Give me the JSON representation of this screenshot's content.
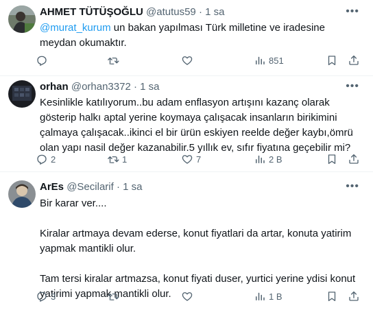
{
  "tweets": [
    {
      "name": "AHMET TÜTÜŞOĞLU",
      "handle": "@atutus59",
      "sep": "·",
      "time": "1 sa",
      "mention": "@murat_kurum",
      "text": " un bakan yapılması Türk milletine ve iradesine meydan okumaktır.",
      "replies": "",
      "retweets": "",
      "likes": "",
      "views": "851"
    },
    {
      "name": "orhan",
      "handle": "@orhan3372",
      "sep": "·",
      "time": "1 sa",
      "text": "Kesinlikle katılıyorum..bu adam enflasyon artışını kazanç olarak gösterip halkı aptal yerine koymaya çalışacak insanların birikimini çalmaya çalışacak..ikinci el bir ürün eskiyen reelde değer kaybı,ömrü olan yapı nasil değer kazanabilir.5 yıllık ev, sıfır fiyatına geçebilir mi?",
      "replies": "2",
      "retweets": "1",
      "likes": "7",
      "views": "2 B"
    },
    {
      "name": "ArEs",
      "handle": "@Secilarif",
      "sep": "·",
      "time": "1 sa",
      "text": "Bir karar ver....\n\nKiralar artmaya devam ederse, konut fiyatlari da artar, konuta yatirim yapmak mantikli olur.\n\nTam tersi kiralar artmazsa, konut fiyati duser, yurtici yerine ydisi konut yatirimi yapmak mantikli olur.",
      "replies": "3",
      "retweets": "",
      "likes": "",
      "views": "1 B"
    }
  ],
  "icons": {
    "more": "more-icon",
    "reply": "reply-icon",
    "retweet": "retweet-icon",
    "like": "heart-icon",
    "views": "views-icon",
    "bookmark": "bookmark-icon",
    "share": "share-icon"
  },
  "colors": {
    "link": "#1d9bf0",
    "secondary": "#536471",
    "divider": "#eff3f4"
  }
}
